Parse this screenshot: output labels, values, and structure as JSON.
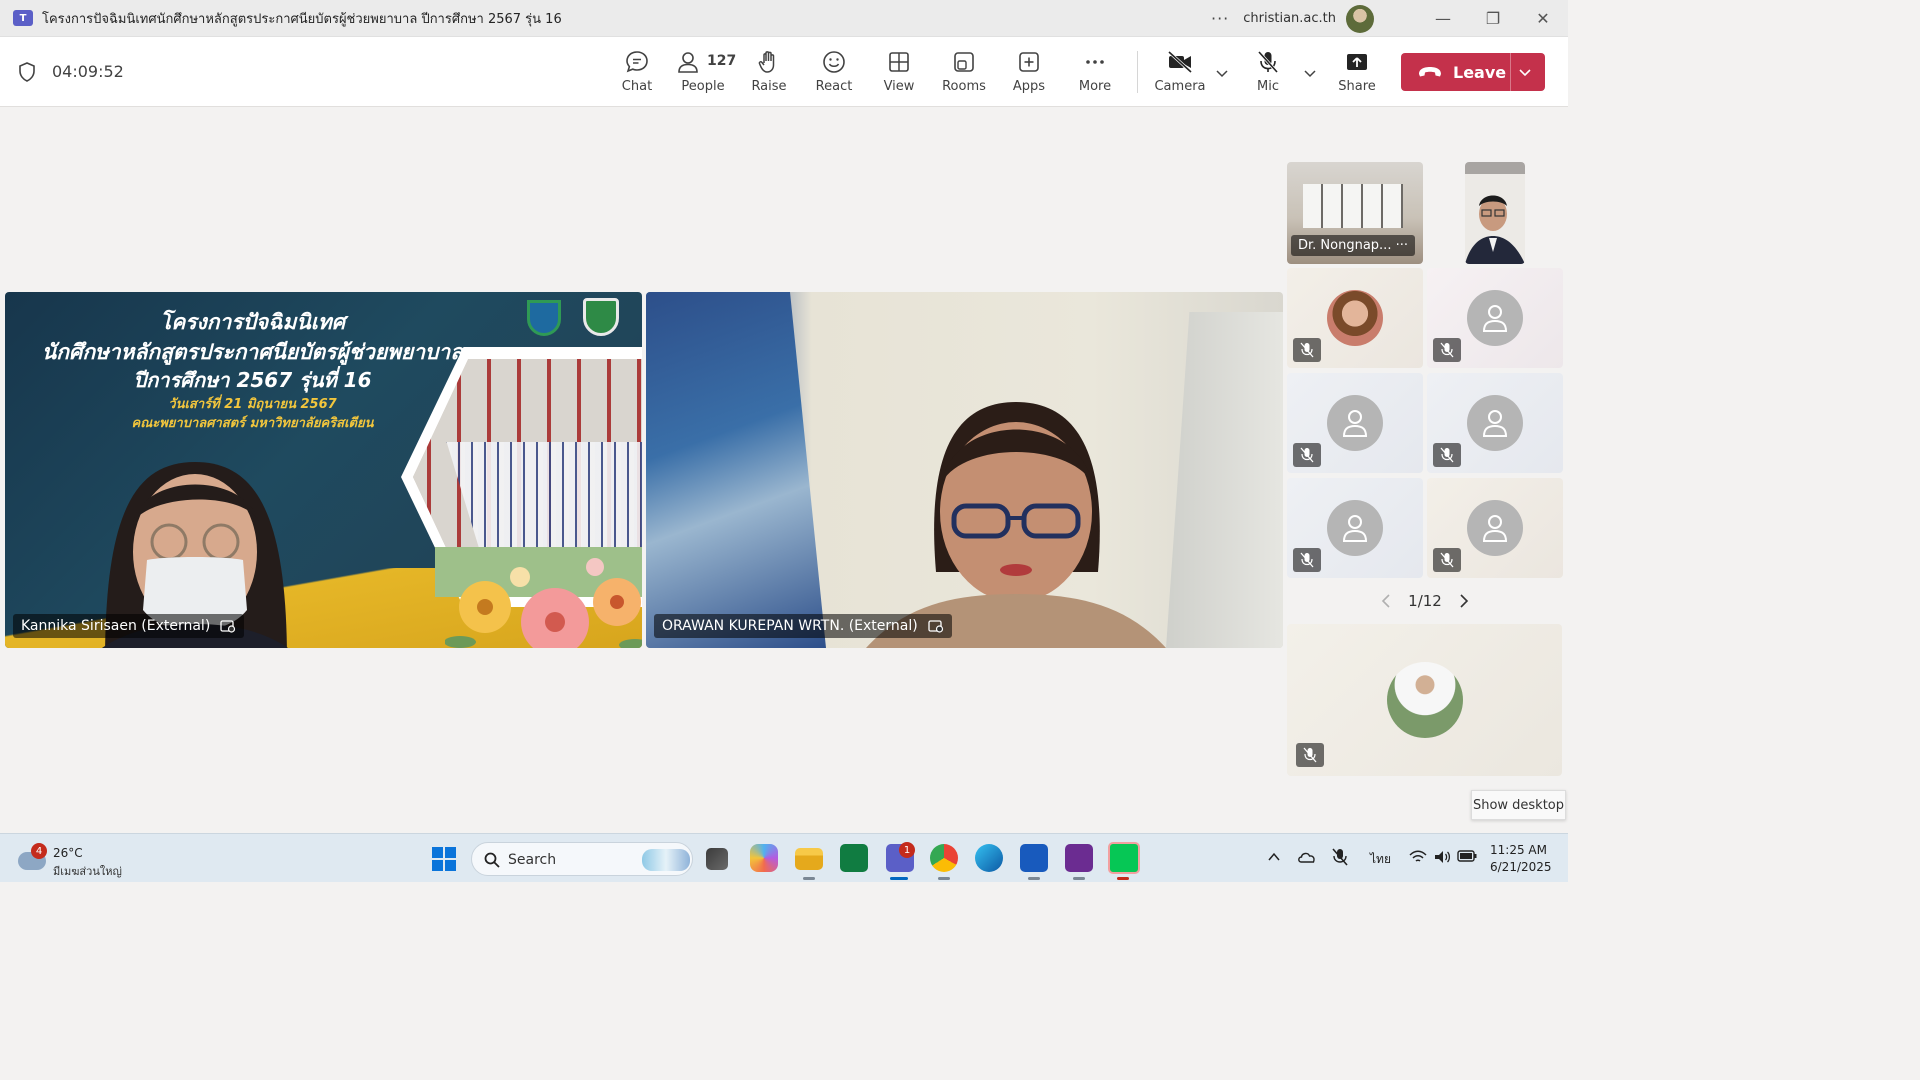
{
  "window": {
    "title": "โครงการปัจฉิมนิเทศนักศึกษาหลักสูตรประกาศนียบัตรผู้ช่วยพยาบาล ปีการศึกษา 2567 รุ่น 16",
    "account": "christian.ac.th",
    "app_icon": "teams-icon",
    "more_icon": "more-options-icon"
  },
  "meeting": {
    "timer": "04:09:52",
    "people_count": "127",
    "buttons": {
      "chat": "Chat",
      "people": "People",
      "raise": "Raise",
      "react": "React",
      "view": "View",
      "rooms": "Rooms",
      "apps": "Apps",
      "more": "More",
      "camera": "Camera",
      "mic": "Mic",
      "share": "Share",
      "leave": "Leave"
    },
    "leave_color": "#c4314b"
  },
  "stage": {
    "tile1": {
      "name": "Kannika Sirisaen (External)",
      "slide_line1": "โครงการปัจฉิมนิเทศ",
      "slide_line2": "นักศึกษาหลักสูตรประกาศนียบัตรผู้ช่วยพยาบาล",
      "slide_line3": "ปีการศึกษา 2567 รุ่นที่ 16",
      "slide_line4": "วันเสาร์ที่ 21 มิถุนายน 2567",
      "slide_line5": "คณะพยาบาลศาสตร์ มหาวิทยาลัยคริสเตียน"
    },
    "tile2": {
      "name": "ORAWAN KUREPAN WRTN. (External)"
    },
    "gallery": {
      "featured_name": "Dr. Nongnap...",
      "page": "1/12"
    },
    "show_desktop": "Show desktop"
  },
  "taskbar": {
    "weather_badge": "4",
    "temperature": "26°C",
    "weather_desc": "มีเมฆส่วนใหญ่",
    "search_placeholder": "Search",
    "teams_badge": "1",
    "language": "ไทย",
    "time": "11:25 AM",
    "date": "6/21/2025"
  }
}
